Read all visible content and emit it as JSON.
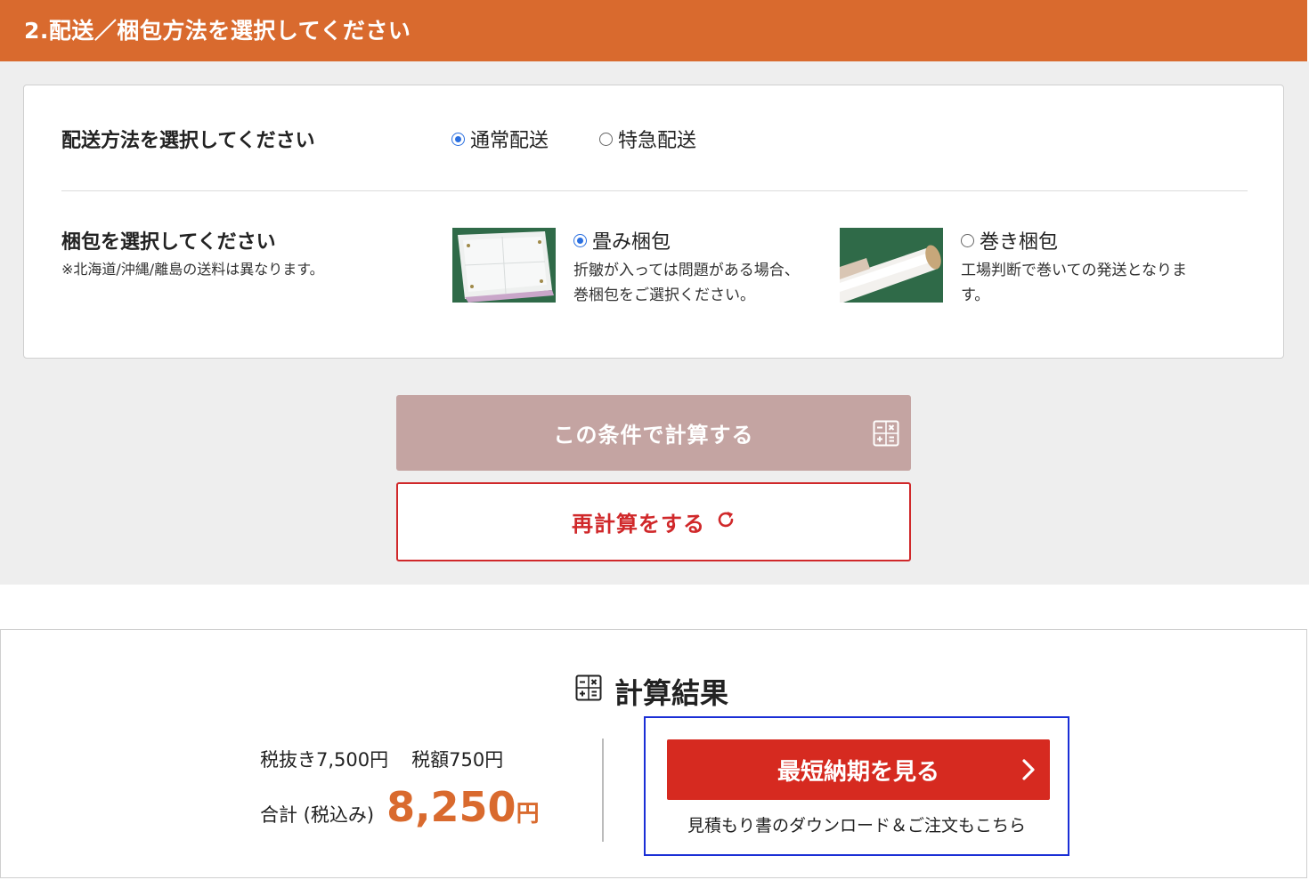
{
  "section": {
    "title": "2.配送／梱包方法を選択してください"
  },
  "delivery": {
    "label": "配送方法を選択してください",
    "options": [
      {
        "label": "通常配送",
        "selected": true
      },
      {
        "label": "特急配送",
        "selected": false
      }
    ]
  },
  "packing": {
    "label": "梱包を選択してください",
    "note": "※北海道/沖縄/離島の送料は異なります。",
    "options": [
      {
        "label": "畳み梱包",
        "selected": true,
        "desc_line1": "折皺が入っては問題がある場合、",
        "desc_line2": "巻梱包をご選択ください。",
        "image": "folded-package-photo"
      },
      {
        "label": "巻き梱包",
        "selected": false,
        "desc_line1": "工場判断で巻いての発送となりま",
        "desc_line2": "す。",
        "image": "rolled-package-photo"
      }
    ]
  },
  "buttons": {
    "calculate": "この条件で計算する",
    "recalculate": "再計算をする"
  },
  "result": {
    "title": "計算結果",
    "subtotal": "税抜き7,500円",
    "tax": "税額750円",
    "total_label": "合計 (税込み)",
    "total_amount": "8,250",
    "total_unit": "円",
    "cta_label": "最短納期を見る",
    "cta_sub": "見積もり書のダウンロード＆ご注文もこちら"
  },
  "colors": {
    "header": "#d96a2e",
    "accent_red": "#d62a20",
    "radio_selected": "#2a6fe0"
  }
}
